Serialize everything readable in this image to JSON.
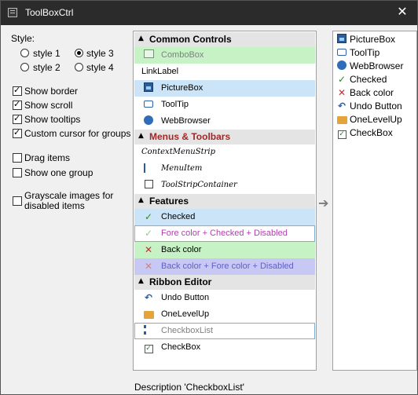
{
  "window": {
    "title": "ToolBoxCtrl",
    "close_glyph": "✕"
  },
  "options": {
    "style_label": "Style:",
    "styles": [
      {
        "label": "style 1",
        "checked": false
      },
      {
        "label": "style 3",
        "checked": true
      },
      {
        "label": "style 2",
        "checked": false
      },
      {
        "label": "style 4",
        "checked": false
      }
    ],
    "checks": [
      {
        "label": "Show border",
        "checked": true
      },
      {
        "label": "Show scroll",
        "checked": true
      },
      {
        "label": "Show tooltips",
        "checked": true
      },
      {
        "label": "Custom cursor for groups",
        "checked": true
      },
      {
        "label": "Drag items",
        "checked": false
      },
      {
        "label": "Show one group",
        "checked": false
      }
    ],
    "grayscale": {
      "line1": "Grayscale images for",
      "line2": "disabled items",
      "checked": false
    }
  },
  "toolbox": {
    "common_controls": {
      "header": "Common Controls",
      "combobox": "ComboBox",
      "linklabel": "LinkLabel",
      "picturebox": "PictureBox",
      "tooltip": "ToolTip",
      "webbrowser": "WebBrowser"
    },
    "menus_toolbars": {
      "header": "Menus & Toolbars",
      "contextmenustrip": "ContextMenuStrip",
      "menuitem": "MenuItem",
      "toolstripcontainer": "ToolStripContainer"
    },
    "features": {
      "header": "Features",
      "checked": "Checked",
      "fore_checked_disabled": "Fore color + Checked + Disabled",
      "back_color": "Back color",
      "back_fore_disabled": "Back color + Fore color + Disabled"
    },
    "ribbon_editor": {
      "header": "Ribbon Editor",
      "undo_button": "Undo Button",
      "onelevelup": "OneLevelUp",
      "checkboxlist": "CheckboxList",
      "checkbox": "CheckBox"
    }
  },
  "right_list": {
    "items": [
      "PictureBox",
      "ToolTip",
      "WebBrowser",
      "Checked",
      "Back color",
      "Undo Button",
      "OneLevelUp",
      "CheckBox"
    ]
  },
  "arrow_glyph": "➔",
  "description": "Description 'CheckboxList'",
  "colors": {
    "title_bg": "#2b2b2b",
    "selected_blue": "#cce4f7",
    "green_bg": "#c6f2c6",
    "purple_bg": "#c8c8f5",
    "menus_header_text": "#a02828",
    "fore_color_text": "#b040b0",
    "combo_text": "#808080"
  }
}
